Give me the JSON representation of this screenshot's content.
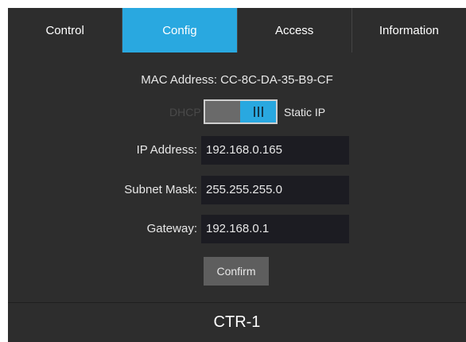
{
  "tabs": [
    {
      "label": "Control",
      "active": false
    },
    {
      "label": "Config",
      "active": true
    },
    {
      "label": "Access",
      "active": false
    },
    {
      "label": "Information",
      "active": false
    }
  ],
  "mac": {
    "label": "MAC Address:",
    "value": "CC-8C-DA-35-B9-CF"
  },
  "mode_toggle": {
    "off_label": "DHCP",
    "on_label": "Static IP",
    "selected": "Static IP"
  },
  "fields": {
    "ip": {
      "label": "IP Address:",
      "value": "192.168.0.165"
    },
    "subnet": {
      "label": "Subnet Mask:",
      "value": "255.255.255.0"
    },
    "gateway": {
      "label": "Gateway:",
      "value": "192.168.0.1"
    }
  },
  "confirm_label": "Confirm",
  "device_name": "CTR-1",
  "colors": {
    "accent": "#29a8e0",
    "background": "#2d2d2d",
    "input_bg": "#1c1c22"
  }
}
